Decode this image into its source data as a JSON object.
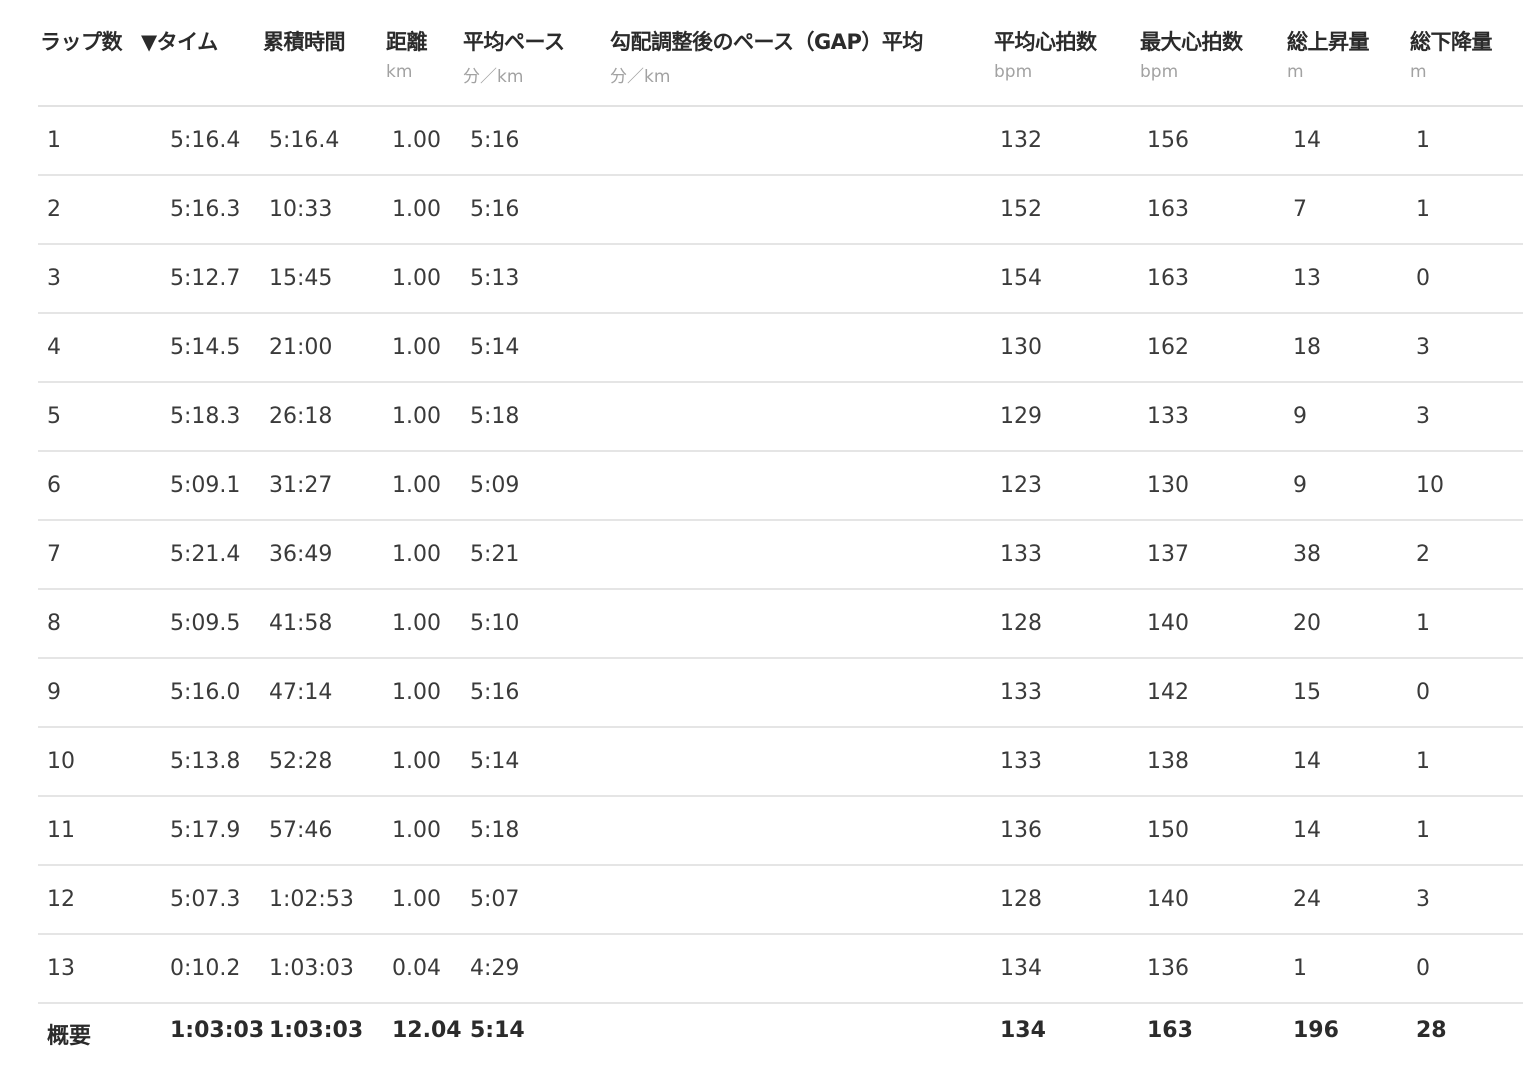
{
  "headers": {
    "lap": {
      "label": "ラップ数",
      "unit": ""
    },
    "time": {
      "label": "▼タイム",
      "unit": ""
    },
    "cumulative": {
      "label": "累積時間",
      "unit": ""
    },
    "distance": {
      "label": "距離",
      "unit": "km"
    },
    "avg_pace": {
      "label": "平均ペース",
      "unit": "分／km"
    },
    "gap": {
      "label": "勾配調整後のペース（GAP）平均",
      "unit": "分／km"
    },
    "avg_hr": {
      "label": "平均心拍数",
      "unit": "bpm"
    },
    "max_hr": {
      "label": "最大心拍数",
      "unit": "bpm"
    },
    "ascent": {
      "label": "総上昇量",
      "unit": "m"
    },
    "descent": {
      "label": "総下降量",
      "unit": "m"
    }
  },
  "rows": [
    {
      "lap": "1",
      "time": "5:16.4",
      "cumulative": "5:16.4",
      "distance": "1.00",
      "avg_pace": "5:16",
      "gap": "",
      "avg_hr": "132",
      "max_hr": "156",
      "ascent": "14",
      "descent": "1"
    },
    {
      "lap": "2",
      "time": "5:16.3",
      "cumulative": "10:33",
      "distance": "1.00",
      "avg_pace": "5:16",
      "gap": "",
      "avg_hr": "152",
      "max_hr": "163",
      "ascent": "7",
      "descent": "1"
    },
    {
      "lap": "3",
      "time": "5:12.7",
      "cumulative": "15:45",
      "distance": "1.00",
      "avg_pace": "5:13",
      "gap": "",
      "avg_hr": "154",
      "max_hr": "163",
      "ascent": "13",
      "descent": "0"
    },
    {
      "lap": "4",
      "time": "5:14.5",
      "cumulative": "21:00",
      "distance": "1.00",
      "avg_pace": "5:14",
      "gap": "",
      "avg_hr": "130",
      "max_hr": "162",
      "ascent": "18",
      "descent": "3"
    },
    {
      "lap": "5",
      "time": "5:18.3",
      "cumulative": "26:18",
      "distance": "1.00",
      "avg_pace": "5:18",
      "gap": "",
      "avg_hr": "129",
      "max_hr": "133",
      "ascent": "9",
      "descent": "3"
    },
    {
      "lap": "6",
      "time": "5:09.1",
      "cumulative": "31:27",
      "distance": "1.00",
      "avg_pace": "5:09",
      "gap": "",
      "avg_hr": "123",
      "max_hr": "130",
      "ascent": "9",
      "descent": "10"
    },
    {
      "lap": "7",
      "time": "5:21.4",
      "cumulative": "36:49",
      "distance": "1.00",
      "avg_pace": "5:21",
      "gap": "",
      "avg_hr": "133",
      "max_hr": "137",
      "ascent": "38",
      "descent": "2"
    },
    {
      "lap": "8",
      "time": "5:09.5",
      "cumulative": "41:58",
      "distance": "1.00",
      "avg_pace": "5:10",
      "gap": "",
      "avg_hr": "128",
      "max_hr": "140",
      "ascent": "20",
      "descent": "1"
    },
    {
      "lap": "9",
      "time": "5:16.0",
      "cumulative": "47:14",
      "distance": "1.00",
      "avg_pace": "5:16",
      "gap": "",
      "avg_hr": "133",
      "max_hr": "142",
      "ascent": "15",
      "descent": "0"
    },
    {
      "lap": "10",
      "time": "5:13.8",
      "cumulative": "52:28",
      "distance": "1.00",
      "avg_pace": "5:14",
      "gap": "",
      "avg_hr": "133",
      "max_hr": "138",
      "ascent": "14",
      "descent": "1"
    },
    {
      "lap": "11",
      "time": "5:17.9",
      "cumulative": "57:46",
      "distance": "1.00",
      "avg_pace": "5:18",
      "gap": "",
      "avg_hr": "136",
      "max_hr": "150",
      "ascent": "14",
      "descent": "1"
    },
    {
      "lap": "12",
      "time": "5:07.3",
      "cumulative": "1:02:53",
      "distance": "1.00",
      "avg_pace": "5:07",
      "gap": "",
      "avg_hr": "128",
      "max_hr": "140",
      "ascent": "24",
      "descent": "3"
    },
    {
      "lap": "13",
      "time": "0:10.2",
      "cumulative": "1:03:03",
      "distance": "0.04",
      "avg_pace": "4:29",
      "gap": "",
      "avg_hr": "134",
      "max_hr": "136",
      "ascent": "1",
      "descent": "0"
    }
  ],
  "summary": {
    "lap": "概要",
    "time": "1:03:03",
    "cumulative": "1:03:03",
    "distance": "12.04",
    "avg_pace": "5:14",
    "gap": "",
    "avg_hr": "134",
    "max_hr": "163",
    "ascent": "196",
    "descent": "28"
  }
}
